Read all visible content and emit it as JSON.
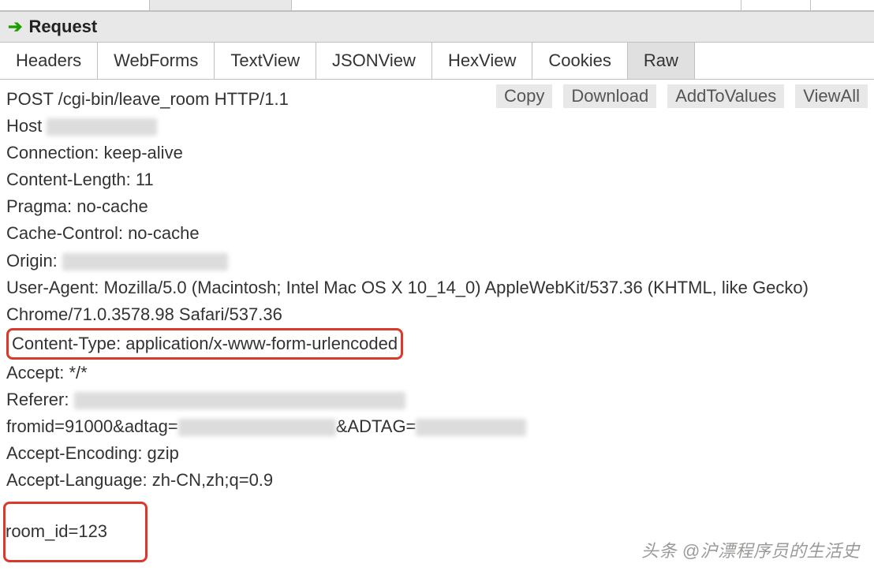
{
  "section": {
    "title": "Request"
  },
  "tabs": {
    "items": [
      {
        "label": "Headers"
      },
      {
        "label": "WebForms"
      },
      {
        "label": "TextView"
      },
      {
        "label": "JSONView"
      },
      {
        "label": "HexView"
      },
      {
        "label": "Cookies"
      },
      {
        "label": "Raw"
      }
    ],
    "active_index": 6
  },
  "actions": {
    "copy": "Copy",
    "download": "Download",
    "addtovalues": "AddToValues",
    "viewall": "ViewAll"
  },
  "raw": {
    "request_line": "POST /cgi-bin/leave_room HTTP/1.1",
    "host_label": "Host",
    "connection": "Connection: keep-alive",
    "content_length": "Content-Length: 11",
    "pragma": "Pragma: no-cache",
    "cache_control": "Cache-Control: no-cache",
    "origin_label": "Origin:",
    "user_agent": "User-Agent: Mozilla/5.0 (Macintosh; Intel Mac OS X 10_14_0) AppleWebKit/537.36 (KHTML, like Gecko) Chrome/71.0.3578.98 Safari/537.36",
    "content_type": "Content-Type: application/x-www-form-urlencoded",
    "accept": "Accept: */*",
    "referer_label": "Referer:",
    "fromid_prefix": "fromid=91000&adtag=",
    "adtag_label": "&ADTAG=",
    "accept_encoding": "Accept-Encoding: gzip",
    "accept_language": "Accept-Language: zh-CN,zh;q=0.9",
    "body": "room_id=123"
  },
  "watermark": "头条 @沪漂程序员的生活史"
}
